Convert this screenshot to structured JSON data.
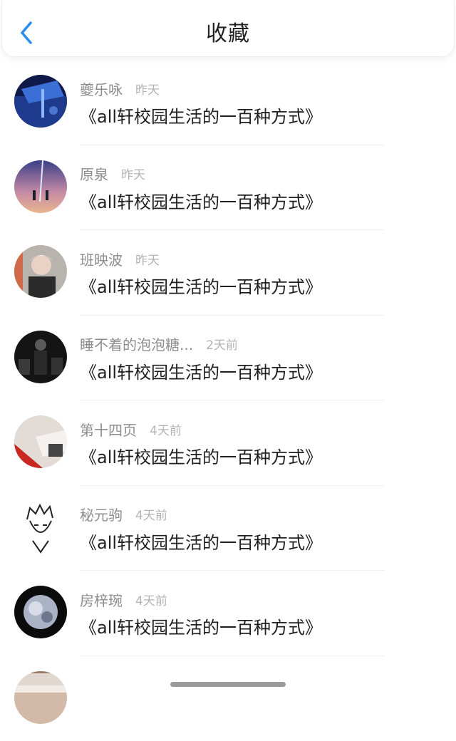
{
  "header": {
    "title": "收藏",
    "back_icon": "chevron-left-icon",
    "accent": "#2a8ef0"
  },
  "items": [
    {
      "name": "夔乐咏",
      "time": "昨天",
      "work": "《all轩校园生活的一百种方式》"
    },
    {
      "name": "原泉",
      "time": "昨天",
      "work": "《all轩校园生活的一百种方式》"
    },
    {
      "name": "班映波",
      "time": "昨天",
      "work": "《all轩校园生活的一百种方式》"
    },
    {
      "name": "睡不着的泡泡糖...",
      "time": "2天前",
      "work": "《all轩校园生活的一百种方式》"
    },
    {
      "name": "第十四页",
      "time": "4天前",
      "work": "《all轩校园生活的一百种方式》"
    },
    {
      "name": "秘元驹",
      "time": "4天前",
      "work": "《all轩校园生活的一百种方式》"
    },
    {
      "name": "房梓琬",
      "time": "4天前",
      "work": "《all轩校园生活的一百种方式》"
    }
  ]
}
